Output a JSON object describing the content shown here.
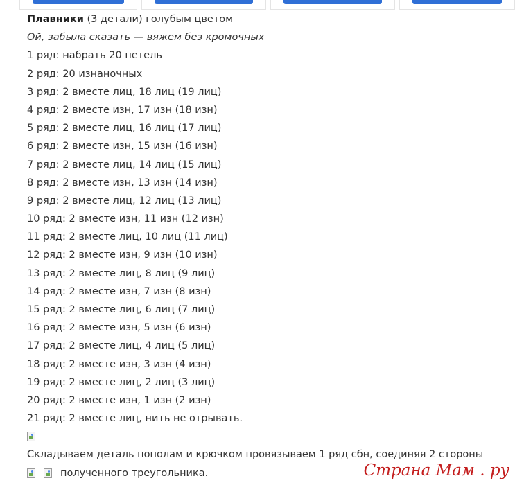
{
  "heading": {
    "bold": "Плавники",
    "rest": " (3 детали) голубым цветом"
  },
  "note": "Ой, забыла сказать — вяжем без кромочных",
  "rows": [
    "1 ряд: набрать 20 петель",
    "2 ряд: 20 изнаночных",
    "3 ряд: 2 вместе лиц, 18 лиц (19 лиц)",
    "4 ряд: 2 вместе изн, 17 изн (18 изн)",
    "5 ряд: 2 вместе лиц, 16 лиц (17 лиц)",
    "6 ряд: 2 вместе изн, 15 изн (16 изн)",
    "7 ряд: 2 вместе лиц, 14 лиц (15 лиц)",
    "8 ряд: 2 вместе изн, 13 изн (14 изн)",
    "9 ряд: 2 вместе лиц, 12 лиц (13 лиц)",
    "10 ряд: 2 вместе изн, 11 изн (12 изн)",
    "11 ряд: 2 вместе лиц, 10 лиц (11 лиц)",
    "12 ряд: 2 вместе изн, 9 изн (10 изн)",
    "13 ряд: 2 вместе лиц, 8 лиц (9 лиц)",
    "14 ряд: 2 вместе изн, 7 изн (8 изн)",
    "15 ряд: 2 вместе лиц, 6 лиц (7 лиц)",
    "16 ряд: 2 вместе изн, 5 изн (6 изн)",
    "17 ряд: 2 вместе лиц, 4 лиц (5 лиц)",
    "18 ряд: 2 вместе изн, 3 изн (4 изн)",
    "19 ряд: 2 вместе лиц, 2 лиц (3 лиц)",
    "20 ряд: 2 вместе изн, 1 изн (2 изн)",
    "21 ряд: 2 вместе лиц, нить не отрывать."
  ],
  "fold_text": "Складываем деталь пополам и крючком провязываем 1 ряд сбн, соединяя 2 стороны",
  "triangle_text": "полученного треугольника.",
  "watermark": "Страна Мам . ру",
  "colors": {
    "accent_button": "#2f6fd6",
    "watermark": "#c41e1e"
  }
}
